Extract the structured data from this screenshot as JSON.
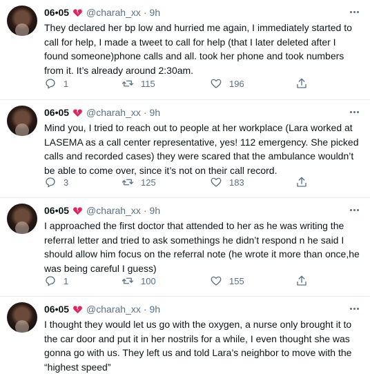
{
  "tweets": [
    {
      "name": "06•05",
      "handle": "@charah_xx",
      "separator": "·",
      "time": "9h",
      "text": "They declared her bp low and hurried me again, I immediately started to call for help, I made a tweet to call for help (that I later deleted after I found someone)phone calls and all. took her phone and took numbers from it. It’s already around 2:30am.",
      "replies": "1",
      "retweets": "115",
      "likes": "196"
    },
    {
      "name": "06•05",
      "handle": "@charah_xx",
      "separator": "·",
      "time": "9h",
      "text": "Mind you, I tried to reach out to people at her workplace (Lara worked at LASEMA as a call center representative, yes! 112 emergency. She picked calls and recorded cases) they were scared that the ambulance wouldn’t be able to come over, since it’s not on their call record.",
      "replies": "3",
      "retweets": "125",
      "likes": "183"
    },
    {
      "name": "06•05",
      "handle": "@charah_xx",
      "separator": "·",
      "time": "9h",
      "text": "I approached the first doctor that attended to her as he was writing the referral letter and tried to ask somethings he didn’t respond n he said I should allow him focus on the referral note (he wrote it more than once,he was being careful I guess)",
      "replies": "1",
      "retweets": "100",
      "likes": "155"
    },
    {
      "name": "06•05",
      "handle": "@charah_xx",
      "separator": "·",
      "time": "9h",
      "text": "I thought they would let us go with the oxygen, a nurse only brought it to the car door and put it in her nostrils for a while, I even thought she was gonna go with us. They left us and told Lara’s neighbor to move with the “highest speed”"
    }
  ]
}
